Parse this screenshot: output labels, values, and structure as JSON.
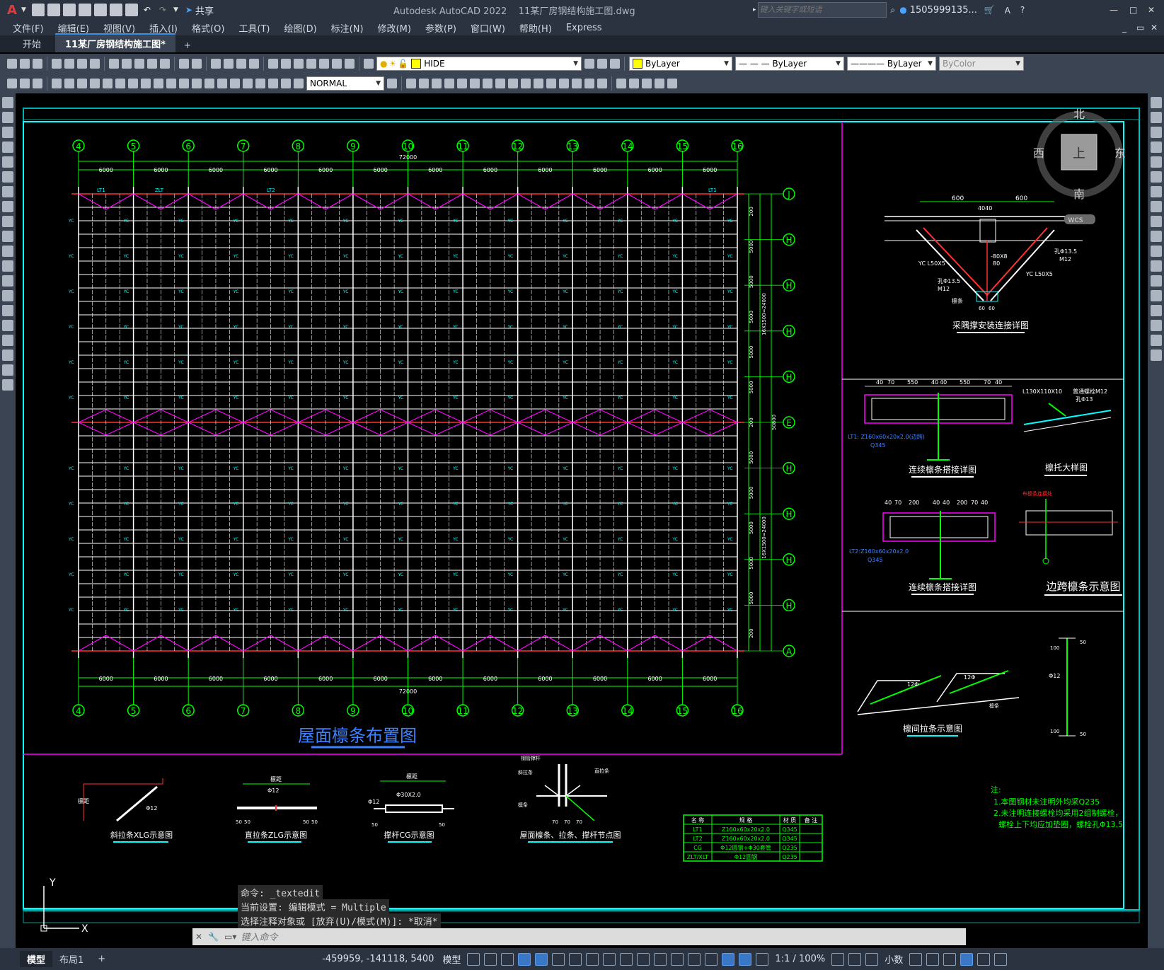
{
  "app": {
    "logo": "A",
    "title": "Autodesk AutoCAD 2022    11某厂房钢结构施工图.dwg",
    "share": "共享",
    "search_placeholder": "键入关键字或短语",
    "user": "1505999135..."
  },
  "menu": [
    "文件(F)",
    "编辑(E)",
    "视图(V)",
    "插入(I)",
    "格式(O)",
    "工具(T)",
    "绘图(D)",
    "标注(N)",
    "修改(M)",
    "参数(P)",
    "窗口(W)",
    "帮助(H)",
    "Express"
  ],
  "tabs": {
    "start": "开始",
    "active": "11某厂房钢结构施工图*",
    "add": "+"
  },
  "toolbar": {
    "layer_name": "HIDE",
    "color": "ByLayer",
    "linetype": "— — — ByLayer",
    "lineweight": "———— ByLayer",
    "plotstyle": "ByColor",
    "dimstyle": "NORMAL",
    "layer_color": "#ffff00"
  },
  "viewcube": {
    "north": "北",
    "south": "南",
    "east": "东",
    "west": "西",
    "top": "上",
    "wcs": "WCS"
  },
  "plan": {
    "title": "屋面檩条布置图",
    "top_axes": [
      "4",
      "5",
      "6",
      "7",
      "8",
      "9",
      "10",
      "11",
      "12",
      "13",
      "14",
      "15",
      "16"
    ],
    "right_axes": [
      "J",
      "H",
      "H",
      "H",
      "H",
      "E",
      "H",
      "H",
      "H",
      "H",
      "A"
    ],
    "bay": "6000",
    "total": "72000",
    "right_dims": [
      "200",
      "5000",
      "5000",
      "5000",
      "5000",
      "5000",
      "200",
      "5000",
      "5000",
      "5000",
      "5000",
      "5000",
      "200"
    ],
    "right_total": "50800",
    "right_sub1": "16X1500=24000",
    "right_sub2": "16X1500=24000",
    "labels": [
      "LT1",
      "ZLT",
      "LT2",
      "LT1",
      "YC",
      "CG",
      "XLT"
    ]
  },
  "details": {
    "d1": {
      "title": "采隅撑安装连接详图",
      "dims": [
        "600",
        "600",
        "4040"
      ],
      "labels": [
        "YC L50X5",
        "孔Φ13.5",
        "M12",
        "-80X8",
        "80",
        "YC L50X5",
        "孔Φ13.5",
        "M12",
        "60",
        "60",
        "檩条"
      ]
    },
    "d2": {
      "title": "连续檩条搭接详图",
      "dims": [
        "40",
        "70",
        "550",
        "40",
        "40",
        "550",
        "70",
        "40"
      ],
      "note1": "LT1: Z160x60x20x2.0(边跨)",
      "note2": "Q345"
    },
    "d3": {
      "title": "檩托大样图",
      "labels": [
        "L130X110X10",
        "普通螺栓M12",
        "孔Φ13"
      ]
    },
    "d4": {
      "title": "连续檩条搭接详图",
      "dims": [
        "40",
        "70",
        "200",
        "40",
        "40",
        "200",
        "70",
        "40"
      ],
      "note1": "LT2:Z160x60x20x2.0",
      "note2": "Q345"
    },
    "d5": {
      "title": "边跨檩条示意图",
      "label": "布檩条连接处"
    },
    "d6": {
      "title": "檩间拉条示意图",
      "labels": [
        "12Φ",
        "12Φ",
        "檩条",
        "Φ12",
        "100",
        "100",
        "50",
        "50"
      ]
    },
    "b1": {
      "title": "斜拉条XLG示意图",
      "labels": [
        "檩距",
        "Φ12"
      ]
    },
    "b2": {
      "title": "直拉条ZLG示意图",
      "labels": [
        "檩距",
        "Φ12",
        "50",
        "50",
        "50",
        "50"
      ]
    },
    "b3": {
      "title": "撑杆CG示意图",
      "labels": [
        "檩距",
        "Φ12",
        "Φ30X2.0",
        "50",
        "50"
      ]
    },
    "b4": {
      "title": "屋面檩条、拉条、撑杆节点图",
      "labels": [
        "钢管撑杆",
        "斜拉条",
        "直拉条",
        "檩条",
        "70",
        "70",
        "70"
      ]
    }
  },
  "table": {
    "headers": [
      "名 称",
      "规 格",
      "材 质",
      "备 注"
    ],
    "rows": [
      [
        "LT1",
        "Z160x60x20x2.0",
        "Q345",
        ""
      ],
      [
        "LT2",
        "Z160x60x20x2.0",
        "Q345",
        ""
      ],
      [
        "CG",
        "Φ12圆钢+Φ30套管",
        "Q235",
        ""
      ],
      [
        "ZLT/XLT",
        "Φ12圆钢",
        "Q235",
        ""
      ]
    ]
  },
  "notes": {
    "title": "注:",
    "lines": [
      "1.本图钢材未注明外均采Q235",
      "2.未注明连接螺栓均采用2组制螺栓，",
      "  螺栓上下均应加垫圈，螺栓孔Φ13.5"
    ]
  },
  "ucs": {
    "y": "Y",
    "x": "X"
  },
  "command": {
    "history": [
      "命令: _textedit",
      "当前设置: 编辑模式 = Multiple",
      "选择注释对象或 [放弃(U)/模式(M)]: *取消*"
    ],
    "placeholder": "键入命令"
  },
  "layout_tabs": [
    "模型",
    "布局1",
    "+"
  ],
  "status": {
    "coords": "-459959, -141118, 5400",
    "model": "模型",
    "scale": "1:1 / 100%",
    "units": "小数"
  },
  "colors": {
    "axis_green": "#00ff00",
    "purlin_white": "#ffffff",
    "brace_magenta": "#ff00ff",
    "beam_red": "#ff3030",
    "label_cyan": "#00ffff",
    "title_blue": "#3c82ff",
    "detail_yellow": "#ffff00"
  }
}
